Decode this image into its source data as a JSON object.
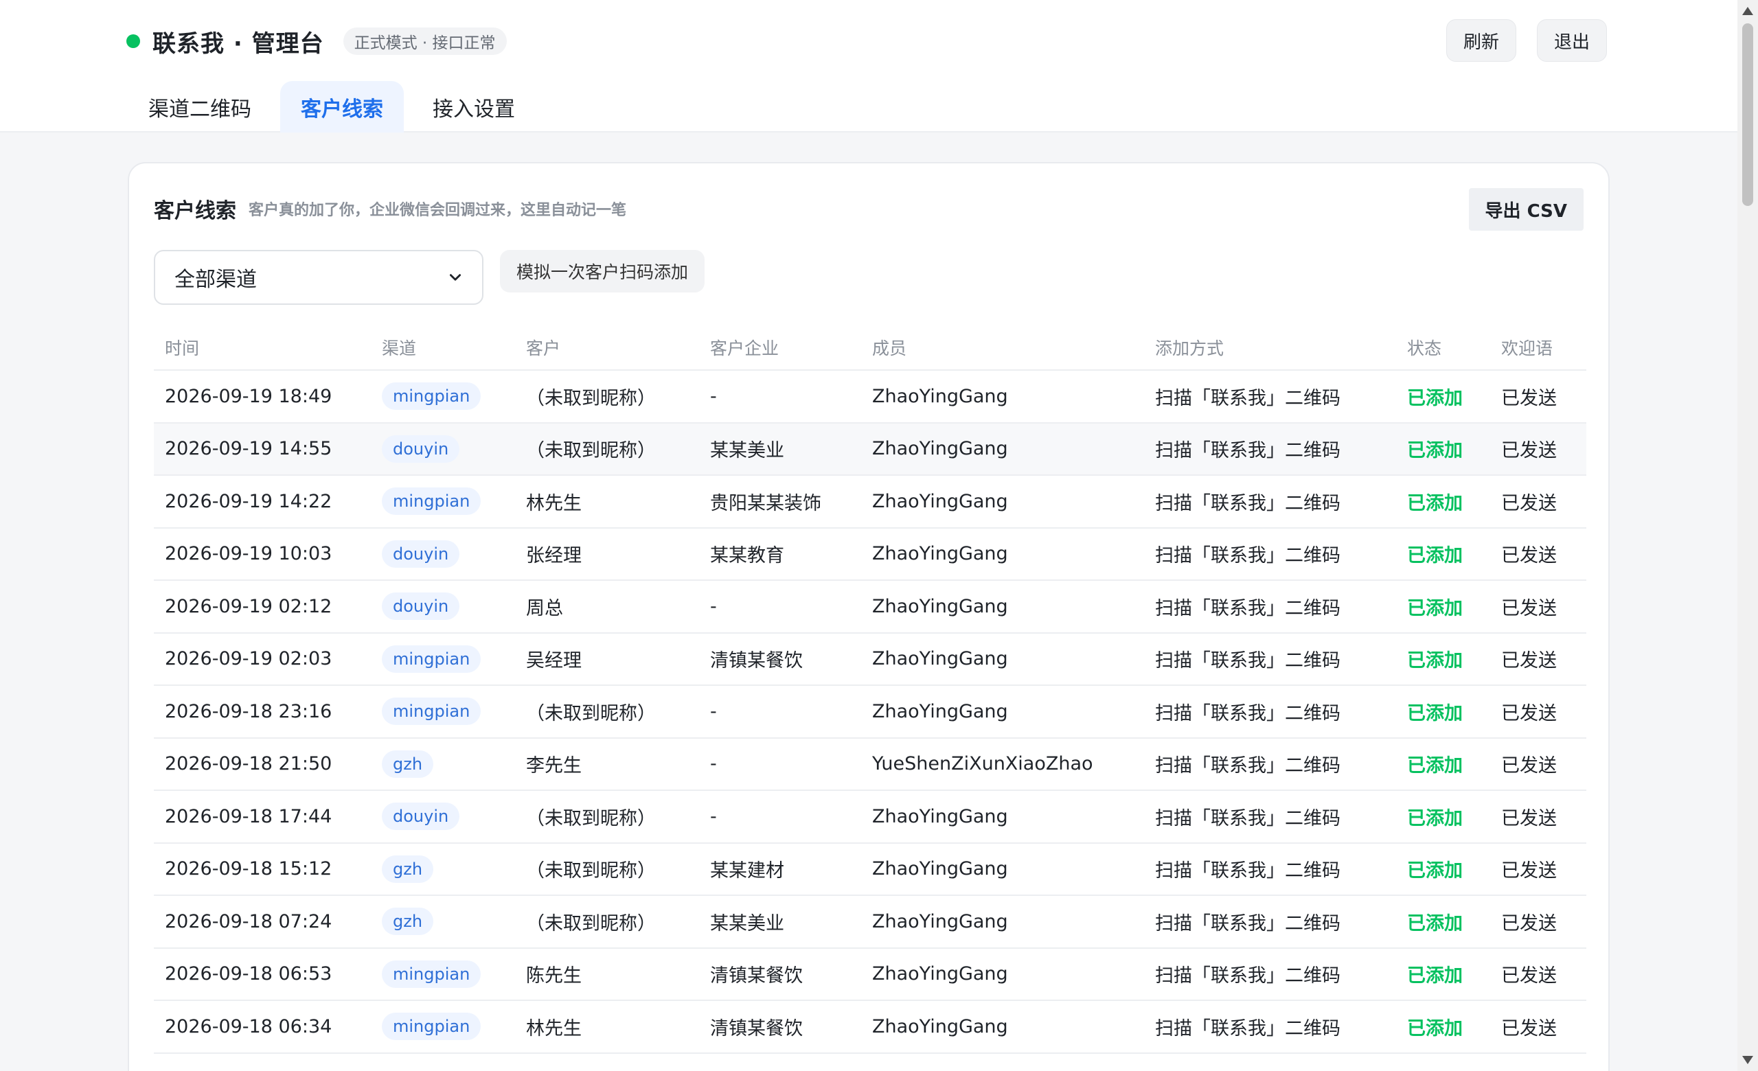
{
  "header": {
    "title": "联系我 · 管理台",
    "mode_badge": "正式模式 · 接口正常",
    "status_color": "#07c160",
    "refresh_label": "刷新",
    "logout_label": "退出"
  },
  "tabs": [
    {
      "label": "渠道二维码",
      "active": false
    },
    {
      "label": "客户线索",
      "active": true
    },
    {
      "label": "接入设置",
      "active": false
    }
  ],
  "panel": {
    "title": "客户线索",
    "subtitle": "客户真的加了你，企业微信会回调过来，这里自动记一笔",
    "export_label": "导出 CSV",
    "channel_select_value": "全部渠道",
    "simulate_label": "模拟一次客户扫码添加"
  },
  "table": {
    "headers": {
      "time": "时间",
      "channel": "渠道",
      "customer": "客户",
      "company": "客户企业",
      "member": "成员",
      "method": "添加方式",
      "state": "状态",
      "welcome": "欢迎语"
    },
    "rows": [
      {
        "time": "2026-09-19 18:49",
        "channel": "mingpian",
        "customer": "（未取到昵称）",
        "company": "-",
        "member": "ZhaoYingGang",
        "method": "扫描「联系我」二维码",
        "state": "已添加",
        "welcome": "已发送"
      },
      {
        "time": "2026-09-19 14:55",
        "channel": "douyin",
        "customer": "（未取到昵称）",
        "company": "某某美业",
        "member": "ZhaoYingGang",
        "method": "扫描「联系我」二维码",
        "state": "已添加",
        "welcome": "已发送"
      },
      {
        "time": "2026-09-19 14:22",
        "channel": "mingpian",
        "customer": "林先生",
        "company": "贵阳某某装饰",
        "member": "ZhaoYingGang",
        "method": "扫描「联系我」二维码",
        "state": "已添加",
        "welcome": "已发送"
      },
      {
        "time": "2026-09-19 10:03",
        "channel": "douyin",
        "customer": "张经理",
        "company": "某某教育",
        "member": "ZhaoYingGang",
        "method": "扫描「联系我」二维码",
        "state": "已添加",
        "welcome": "已发送"
      },
      {
        "time": "2026-09-19 02:12",
        "channel": "douyin",
        "customer": "周总",
        "company": "-",
        "member": "ZhaoYingGang",
        "method": "扫描「联系我」二维码",
        "state": "已添加",
        "welcome": "已发送"
      },
      {
        "time": "2026-09-19 02:03",
        "channel": "mingpian",
        "customer": "吴经理",
        "company": "清镇某餐饮",
        "member": "ZhaoYingGang",
        "method": "扫描「联系我」二维码",
        "state": "已添加",
        "welcome": "已发送"
      },
      {
        "time": "2026-09-18 23:16",
        "channel": "mingpian",
        "customer": "（未取到昵称）",
        "company": "-",
        "member": "ZhaoYingGang",
        "method": "扫描「联系我」二维码",
        "state": "已添加",
        "welcome": "已发送"
      },
      {
        "time": "2026-09-18 21:50",
        "channel": "gzh",
        "customer": "李先生",
        "company": "-",
        "member": "YueShenZiXunXiaoZhao",
        "method": "扫描「联系我」二维码",
        "state": "已添加",
        "welcome": "已发送"
      },
      {
        "time": "2026-09-18 17:44",
        "channel": "douyin",
        "customer": "（未取到昵称）",
        "company": "-",
        "member": "ZhaoYingGang",
        "method": "扫描「联系我」二维码",
        "state": "已添加",
        "welcome": "已发送"
      },
      {
        "time": "2026-09-18 15:12",
        "channel": "gzh",
        "customer": "（未取到昵称）",
        "company": "某某建材",
        "member": "ZhaoYingGang",
        "method": "扫描「联系我」二维码",
        "state": "已添加",
        "welcome": "已发送"
      },
      {
        "time": "2026-09-18 07:24",
        "channel": "gzh",
        "customer": "（未取到昵称）",
        "company": "某某美业",
        "member": "ZhaoYingGang",
        "method": "扫描「联系我」二维码",
        "state": "已添加",
        "welcome": "已发送"
      },
      {
        "time": "2026-09-18 06:53",
        "channel": "mingpian",
        "customer": "陈先生",
        "company": "清镇某餐饮",
        "member": "ZhaoYingGang",
        "method": "扫描「联系我」二维码",
        "state": "已添加",
        "welcome": "已发送"
      },
      {
        "time": "2026-09-18 06:34",
        "channel": "mingpian",
        "customer": "林先生",
        "company": "清镇某餐饮",
        "member": "ZhaoYingGang",
        "method": "扫描「联系我」二维码",
        "state": "已添加",
        "welcome": "已发送"
      }
    ]
  },
  "colors": {
    "accent": "#1f6feb",
    "success": "#07c160",
    "chip_bg": "#eef4ff",
    "chip_text": "#2f6fd6"
  },
  "icons": {
    "status": "status-dot-icon",
    "select": "chevron-down-icon"
  }
}
